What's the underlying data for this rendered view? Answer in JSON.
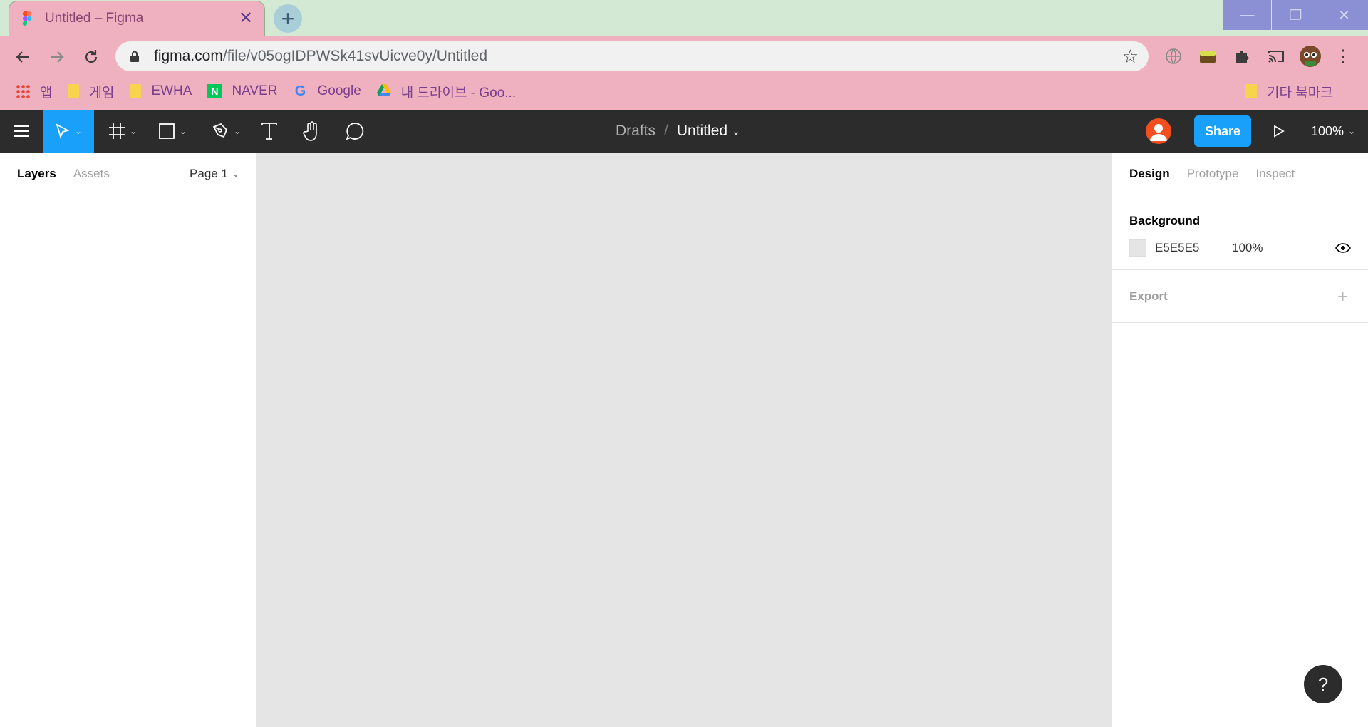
{
  "browser": {
    "tab_title": "Untitled – Figma",
    "tab_close": "✕",
    "new_tab": "+",
    "url_host": "figma.com",
    "url_path": "/file/v05ogIDPWSk41svUicve0y/Untitled",
    "bookmarks": [
      {
        "label": "앱",
        "icon": "apps-grid-icon"
      },
      {
        "label": "게임",
        "icon": "folder-icon"
      },
      {
        "label": "EWHA",
        "icon": "folder-icon"
      },
      {
        "label": "NAVER",
        "icon": "naver-icon"
      },
      {
        "label": "Google",
        "icon": "google-icon"
      },
      {
        "label": "내 드라이브 - Goo...",
        "icon": "drive-icon"
      }
    ],
    "other_bookmarks": "기타 북마크"
  },
  "figma": {
    "breadcrumb_parent": "Drafts",
    "breadcrumb_sep": "/",
    "file_name": "Untitled",
    "share_label": "Share",
    "zoom": "100%",
    "left_tabs": {
      "layers": "Layers",
      "assets": "Assets"
    },
    "page_selector": "Page 1",
    "right_tabs": {
      "design": "Design",
      "prototype": "Prototype",
      "inspect": "Inspect"
    },
    "background_title": "Background",
    "background_hex": "E5E5E5",
    "background_opacity": "100%",
    "background_color": "#E5E5E5",
    "export_title": "Export",
    "help": "?"
  },
  "colors": {
    "accent": "#18A0FB",
    "toolbar": "#2C2C2C",
    "chrome_pink": "#EFB1C0",
    "chrome_green": "#D3E9D3"
  }
}
